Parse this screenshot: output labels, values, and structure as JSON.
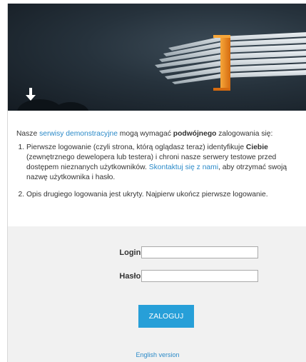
{
  "intro": {
    "prefix": "Nasze ",
    "link_text": "serwisy demonstracyjne",
    "middle": " mogą wymagać ",
    "bold_text": "podwójnego",
    "suffix": " zalogowania się:"
  },
  "steps": [
    {
      "part1": "Pierwsze logowanie (czyli strona, którą oglądasz teraz) identyfikuje ",
      "bold": "Ciebie",
      "part2": " (zewnętrznego dewelopera lub testera) i chroni nasze serwery testowe przed dostępem nieznanych użytkowników. ",
      "link": "Skontaktuj się z nami",
      "part3": ", aby otrzymać swoją nazwę użytkownika i hasło."
    },
    {
      "text": "Opis drugiego logowania jest ukryty. Najpierw ukończ pierwsze logowanie."
    }
  ],
  "form": {
    "login_label": "Login:",
    "login_value": "",
    "password_label": "Hasło:",
    "password_value": "",
    "submit_label": "ZALOGUJ",
    "english_link": "English version"
  },
  "colors": {
    "accent": "#279fd8",
    "link": "#2b8ac8",
    "banner_bar": "#f08a1e",
    "form_bg": "#f1f1f1"
  },
  "icons": {
    "banner_arrow": "arrow-down-icon"
  }
}
